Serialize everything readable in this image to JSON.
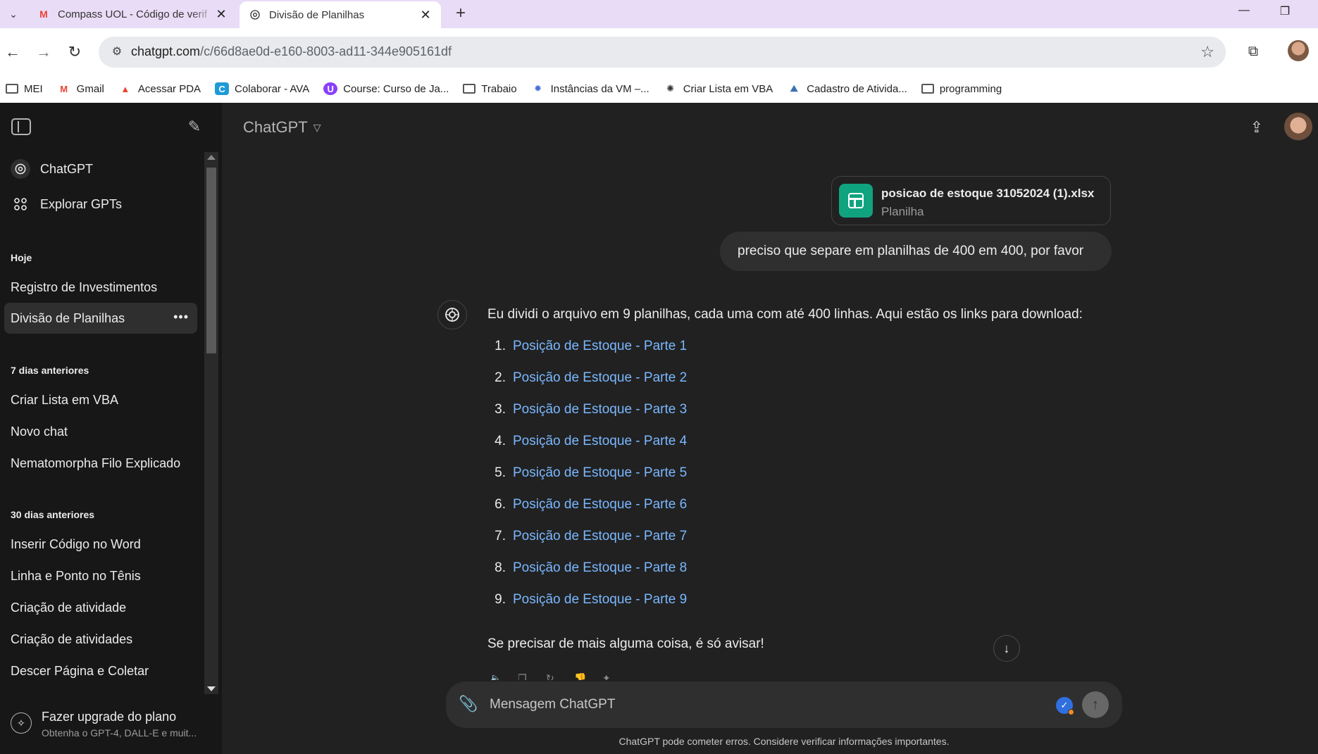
{
  "browser": {
    "tabs": [
      {
        "title": "Compass UOL - Código de verif",
        "icon": "gmail-icon",
        "active": false
      },
      {
        "title": "Divisão de Planilhas",
        "icon": "chatgpt-icon",
        "active": true
      }
    ],
    "url_host": "chatgpt.com",
    "url_path": "/c/66d8ae0d-e160-8003-ad11-344e905161df",
    "bookmarks": [
      {
        "label": "MEI",
        "icon": "folder-icon"
      },
      {
        "label": "Gmail",
        "icon": "gmail-icon"
      },
      {
        "label": "Acessar PDA",
        "icon": "pda-icon"
      },
      {
        "label": "Colaborar - AVA",
        "icon": "colaborar-icon"
      },
      {
        "label": "Course: Curso de Ja...",
        "icon": "course-icon"
      },
      {
        "label": "Trabaio",
        "icon": "folder-icon"
      },
      {
        "label": "Instâncias da VM –...",
        "icon": "gcp-icon"
      },
      {
        "label": "Criar Lista em VBA",
        "icon": "chatgpt-icon"
      },
      {
        "label": "Cadastro de Ativida...",
        "icon": "mountain-icon"
      },
      {
        "label": "programming",
        "icon": "folder-icon"
      }
    ]
  },
  "sidebar": {
    "top_items": [
      {
        "label": "ChatGPT",
        "icon": "chatgpt-icon"
      },
      {
        "label": "Explorar GPTs",
        "icon": "grid-icon"
      }
    ],
    "sections": [
      {
        "heading": "Hoje",
        "items": [
          "Registro de Investimentos",
          "Divisão de Planilhas"
        ]
      },
      {
        "heading": "7 dias anteriores",
        "items": [
          "Criar Lista em VBA",
          "Novo chat",
          "Nematomorpha Filo Explicado"
        ]
      },
      {
        "heading": "30 dias anteriores",
        "items": [
          "Inserir Código no Word",
          "Linha e Ponto no Tênis",
          "Criação de atividade",
          "Criação de atividades",
          "Descer Página e Coletar"
        ]
      }
    ],
    "active_item": "Divisão de Planilhas",
    "upgrade_title": "Fazer upgrade do plano",
    "upgrade_subtitle": "Obtenha o GPT-4, DALL-E e muit..."
  },
  "main": {
    "model": "ChatGPT",
    "attachment": {
      "name": "posicao de estoque 31052024 (1).xlsx",
      "type": "Planilha"
    },
    "user_message": "preciso que separe em planilhas de 400 em 400, por favor",
    "assistant_intro": "Eu dividi o arquivo em 9 planilhas, cada uma com até 400 linhas. Aqui estão os links para download:",
    "links": [
      "Posição de Estoque - Parte 1",
      "Posição de Estoque - Parte 2",
      "Posição de Estoque - Parte 3",
      "Posição de Estoque - Parte 4",
      "Posição de Estoque - Parte 5",
      "Posição de Estoque - Parte 6",
      "Posição de Estoque - Parte 7",
      "Posição de Estoque - Parte 8",
      "Posição de Estoque - Parte 9"
    ],
    "assistant_outro": "Se precisar de mais alguma coisa, é só avisar!",
    "composer_placeholder": "Mensagem ChatGPT",
    "disclaimer": "ChatGPT pode cometer erros. Considere verificar informações importantes."
  },
  "colors": {
    "sidebar_bg": "#171717",
    "main_bg": "#212121",
    "link": "#7ab7ff",
    "file_icon": "#10a37f",
    "tabstrip": "#e9dcf6"
  }
}
